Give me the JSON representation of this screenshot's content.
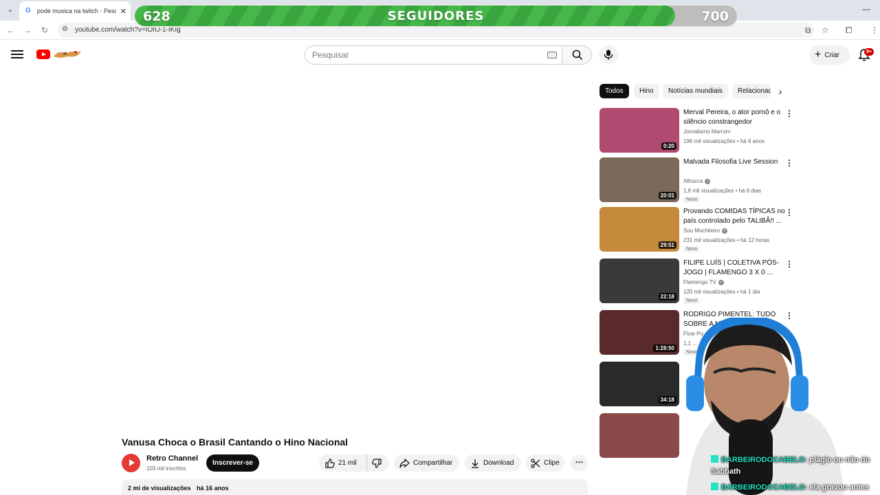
{
  "browser": {
    "tab_title": "pode musica na twitch - Pesquisa",
    "tab_favicon": "G",
    "url": "youtube.com/watch?v=IOhJ-1-IKIg"
  },
  "overlay": {
    "followers_current": "628",
    "followers_label": "SEGUIDORES",
    "followers_goal": "700",
    "progress": 0.897
  },
  "header": {
    "search_placeholder": "Pesquisar",
    "create_label": "Criar",
    "notifications_badge": "9+"
  },
  "video": {
    "title": "Vanusa Choca o Brasil Cantando o Hino Nacional",
    "channel_name": "Retro Channel",
    "channel_subs": "103 mil inscritos",
    "subscribe_label": "Inscrever-se",
    "likes": "21 mil",
    "share_label": "Compartilhar",
    "download_label": "Download",
    "clip_label": "Clipe",
    "views": "2 mi de visualizações",
    "age": "há 16 anos"
  },
  "chips": [
    "Todos",
    "Hino",
    "Notícias mundiais",
    "Relacionados"
  ],
  "recommendations": [
    {
      "title": "Merval Pereira, o ator pornô e o silêncio constrangedor",
      "channel": "Jornalismo Marrom",
      "meta": "196 mil visualizações • há 6 anos",
      "duration": "0:20",
      "badge": "",
      "verified": false,
      "thumb_color": "#b04a70"
    },
    {
      "title": "Malvada Filosofia Live Session",
      "channel": "Alhocca",
      "meta": "1,8 mil visualizações • há 6 dias",
      "duration": "20:01",
      "badge": "Novo",
      "verified": true,
      "thumb_color": "#7a6a5a"
    },
    {
      "title": "Provando COMIDAS TÍPICAS no país controlado pelo TALIBÃ!! ...",
      "channel": "Sou Mochileiro",
      "meta": "231 mil visualizações • há 12 horas",
      "duration": "29:51",
      "badge": "Novo",
      "verified": true,
      "thumb_color": "#c58a3a"
    },
    {
      "title": "FILIPE LUÍS | COLETIVA PÓS-JOGO | FLAMENGO 3 X 0 ...",
      "channel": "Flamengo TV",
      "meta": "120 mil visualizações • há 1 dia",
      "duration": "22:18",
      "badge": "Novo",
      "verified": true,
      "thumb_color": "#3a3a3a"
    },
    {
      "title": "RODRIGO PIMENTEL: TUDO SOBRE A M...",
      "channel": "Flow Po...",
      "meta": "1,1 ...",
      "duration": "1:28:50",
      "badge": "Novo",
      "verified": false,
      "thumb_color": "#5a2a2a"
    },
    {
      "title": "",
      "channel": "",
      "meta": "",
      "duration": "34:18",
      "badge": "",
      "verified": false,
      "thumb_color": "#2a2a2a"
    },
    {
      "title": "",
      "channel": "",
      "meta": "",
      "duration": "",
      "badge": "",
      "verified": false,
      "thumb_color": "#8a4a4a"
    }
  ],
  "chat": [
    {
      "user": "BARBEIRODOCABELO",
      "message": ": plágio ou não do",
      "continuation": "Sabbath"
    },
    {
      "user": "BARBEIRODOCABELO",
      "message": ": ela gravou antes"
    }
  ]
}
